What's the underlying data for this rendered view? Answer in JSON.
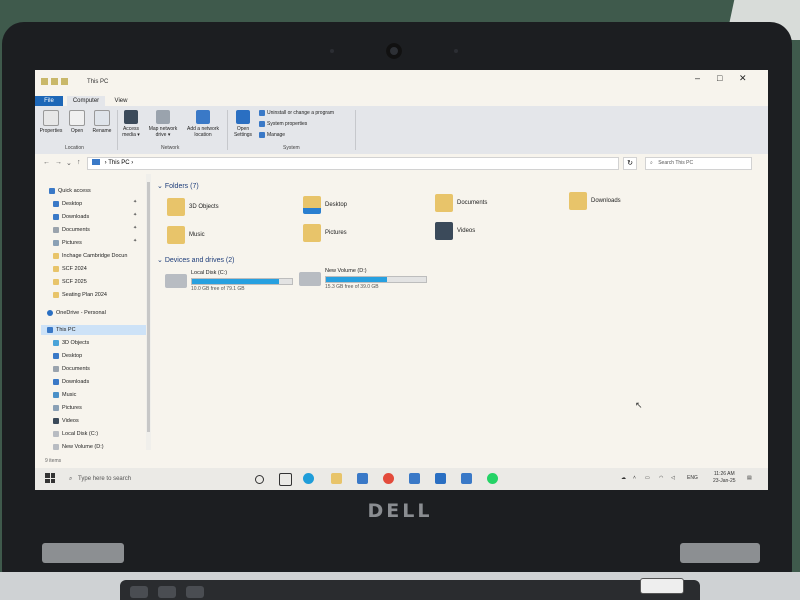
{
  "window": {
    "title": "This PC",
    "controls": [
      "–",
      "□",
      "✕"
    ]
  },
  "ribbon": {
    "tabs": [
      "File",
      "Computer",
      "View"
    ],
    "location": {
      "label": "Location",
      "buttons": [
        "Properties",
        "Open",
        "Rename"
      ]
    },
    "network": {
      "label": "Network",
      "buttons": [
        "Access media ▾",
        "Map network drive ▾",
        "Add a network location"
      ]
    },
    "system": {
      "label": "System",
      "open_settings": "Open Settings",
      "items": [
        "Uninstall or change a program",
        "System properties",
        "Manage"
      ]
    }
  },
  "address": {
    "path": "This PC",
    "search_placeholder": "Search This PC"
  },
  "nav": {
    "quick_access": "Quick access",
    "quick_items": [
      "Desktop",
      "Downloads",
      "Documents",
      "Pictures",
      "Inchage Cambridge Docun",
      "SCF 2024",
      "SCF 2025",
      "Seating Plan 2024"
    ],
    "onedrive": "OneDrive - Personal",
    "this_pc": "This PC",
    "pc_items": [
      "3D Objects",
      "Desktop",
      "Documents",
      "Downloads",
      "Music",
      "Pictures",
      "Videos",
      "Local Disk (C:)",
      "New Volume (D:)"
    ]
  },
  "status_bar": "9 items",
  "content": {
    "folders_header": "Folders (7)",
    "folders": [
      "3D Objects",
      "Desktop",
      "Documents",
      "Downloads",
      "Music",
      "Pictures",
      "Videos"
    ],
    "drives_header": "Devices and drives (2)",
    "drives": [
      {
        "name": "Local Disk (C:)",
        "free": "10.0 GB free of 79.1 GB",
        "used_fraction": 0.87
      },
      {
        "name": "New Volume (D:)",
        "free": "15.3 GB free of 39.0 GB",
        "used_fraction": 0.61
      }
    ]
  },
  "taskbar": {
    "search_placeholder": "Type here to search",
    "language": "ENG",
    "time": "11:26 AM",
    "date": "23-Jan-25"
  },
  "hardware": {
    "logo": "DELL"
  },
  "colors": {
    "accent": "#1d67b7",
    "drive_fill": "#27a0e0",
    "folder": "#e8c46a"
  }
}
